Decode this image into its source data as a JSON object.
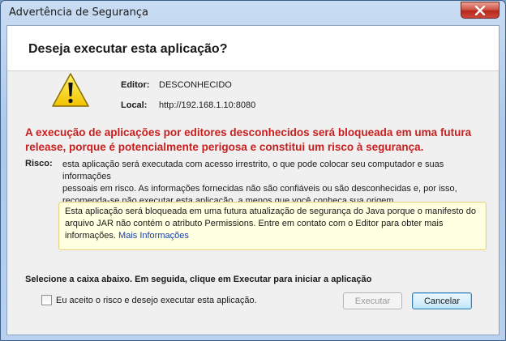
{
  "window": {
    "title": "Advertência de Segurança"
  },
  "dialog": {
    "heading": "Deseja executar esta aplicação?",
    "editor_label": "Editor:",
    "editor_value": "DESCONHECIDO",
    "location_label": "Local:",
    "location_value": "http://192.168.1.10:8080",
    "warning_line1": "A execução de aplicações por editores desconhecidos será bloqueada em uma futura",
    "warning_line2": "release, porque é potencialmente perigosa e constitui um risco à segurança.",
    "risk_label": "Risco:",
    "risk_line1": "esta aplicação será executada com acesso irrestrito, o que pode colocar seu computador e suas informações",
    "risk_line2": "pessoais em risco. As informações fornecidas não são confiáveis ou são desconhecidas e, por isso,",
    "risk_line3": "recomenda-se não executar esta aplicação, a menos que você conheça sua origem",
    "info_line1": "Esta aplicação será bloqueada em uma futura atualização de segurança do Java porque o manifesto do",
    "info_line2": "arquivo JAR não contém o atributo Permissions. Entre em contato com o Editor para obter mais",
    "info_line3": "informações.",
    "more_info_link": "Mais Informações",
    "instruction": "Selecione a caixa abaixo. Em seguida, clique em Executar para iniciar a aplicação",
    "checkbox_label": "Eu aceito o risco e desejo executar esta aplicação.",
    "checkbox_checked": false,
    "run_button": "Executar",
    "run_enabled": false,
    "cancel_button": "Cancelar"
  },
  "icons": {
    "warning": "warning-triangle-icon",
    "close": "close-icon"
  },
  "colors": {
    "warning_text": "#c81e1e",
    "info_background": "#ffffe1",
    "link": "#1b3fa8",
    "close_button": "#c9473a"
  }
}
